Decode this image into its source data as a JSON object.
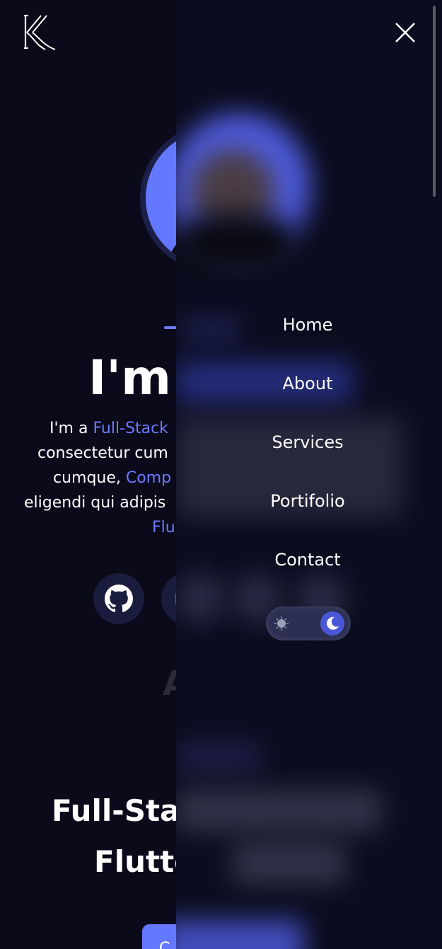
{
  "brand": {
    "logo_text": "KK"
  },
  "hero": {
    "name_partial": "I'm",
    "line1_prefix": "I'm a ",
    "line1_highlight": "Full-Stack",
    "line2": "consectetur cum",
    "line3_prefix": "cumque, ",
    "line3_highlight": "Comp",
    "line4": "eligendi qui adipis",
    "line5_highlight": "Flu"
  },
  "section_ghost": "A",
  "title": {
    "line1": "Full-Sta",
    "line2": "Flutte"
  },
  "cta": {
    "label": "C"
  },
  "nav": {
    "items": [
      "Home",
      "About",
      "Services",
      "Portifolio",
      "Contact"
    ]
  },
  "theme": {
    "mode": "dark"
  },
  "colors": {
    "accent": "#6b7bff",
    "background": "#0a0a1a",
    "drawer": "#0b0c1e"
  }
}
